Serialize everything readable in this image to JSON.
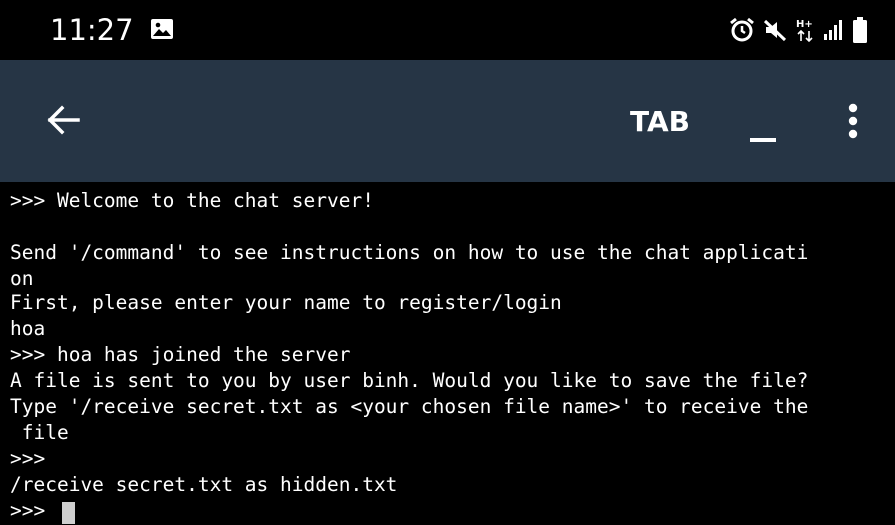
{
  "status_bar": {
    "time": "11:27",
    "icons_left": [
      "image-icon"
    ],
    "icons_right": [
      "alarm-icon",
      "mute-icon",
      "hplus-data-icon",
      "signal-icon",
      "battery-icon"
    ]
  },
  "toolbar": {
    "background": "#263545",
    "back_icon": "arrow-left-icon",
    "tab_label": "TAB",
    "minimize_label": "_",
    "overflow_icon": "more-vertical-icon"
  },
  "terminal": {
    "lines": [
      ">>> Welcome to the chat server!",
      "",
      "Send '/command' to see instructions on how to use the chat applicati",
      "on",
      "First, please enter your name to register/login",
      "hoa",
      ">>> hoa has joined the server",
      "A file is sent to you by user binh. Would you like to save the file?",
      "Type '/receive secret.txt as <your chosen file name>' to receive the",
      " file",
      ">>>",
      "/receive secret.txt as hidden.txt",
      ">>>"
    ]
  }
}
